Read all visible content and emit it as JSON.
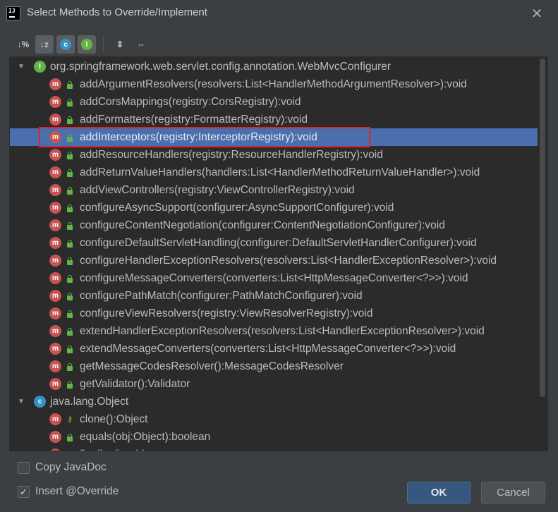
{
  "window": {
    "title": "Select Methods to Override/Implement",
    "close_glyph": "✕",
    "logo_text": "IJ"
  },
  "toolbar": {
    "sort_by_percent_glyph": "↓%",
    "sort_alpha_glyph": "↓z",
    "show_classes_glyph": "c",
    "show_interfaces_glyph": "I",
    "expand_all_glyph": "⇕",
    "collapse_all_glyph": "⇔"
  },
  "tree": {
    "groups": [
      {
        "label": "org.springframework.web.servlet.config.annotation.WebMvcConfigurer",
        "kind_glyph": "I",
        "kind_color": "#62b543",
        "expanded_glyph": "▼",
        "methods": [
          {
            "label": "addArgumentResolvers(resolvers:List<HandlerMethodArgumentResolver>):void",
            "visibility": "public"
          },
          {
            "label": "addCorsMappings(registry:CorsRegistry):void",
            "visibility": "public"
          },
          {
            "label": "addFormatters(registry:FormatterRegistry):void",
            "visibility": "public"
          },
          {
            "label": "addInterceptors(registry:InterceptorRegistry):void",
            "visibility": "public",
            "selected": true
          },
          {
            "label": "addResourceHandlers(registry:ResourceHandlerRegistry):void",
            "visibility": "public"
          },
          {
            "label": "addReturnValueHandlers(handlers:List<HandlerMethodReturnValueHandler>):void",
            "visibility": "public"
          },
          {
            "label": "addViewControllers(registry:ViewControllerRegistry):void",
            "visibility": "public"
          },
          {
            "label": "configureAsyncSupport(configurer:AsyncSupportConfigurer):void",
            "visibility": "public"
          },
          {
            "label": "configureContentNegotiation(configurer:ContentNegotiationConfigurer):void",
            "visibility": "public"
          },
          {
            "label": "configureDefaultServletHandling(configurer:DefaultServletHandlerConfigurer):void",
            "visibility": "public"
          },
          {
            "label": "configureHandlerExceptionResolvers(resolvers:List<HandlerExceptionResolver>):void",
            "visibility": "public"
          },
          {
            "label": "configureMessageConverters(converters:List<HttpMessageConverter<?>>):void",
            "visibility": "public"
          },
          {
            "label": "configurePathMatch(configurer:PathMatchConfigurer):void",
            "visibility": "public"
          },
          {
            "label": "configureViewResolvers(registry:ViewResolverRegistry):void",
            "visibility": "public"
          },
          {
            "label": "extendHandlerExceptionResolvers(resolvers:List<HandlerExceptionResolver>):void",
            "visibility": "public"
          },
          {
            "label": "extendMessageConverters(converters:List<HttpMessageConverter<?>>):void",
            "visibility": "public"
          },
          {
            "label": "getMessageCodesResolver():MessageCodesResolver",
            "visibility": "public"
          },
          {
            "label": "getValidator():Validator",
            "visibility": "public"
          }
        ]
      },
      {
        "label": "java.lang.Object",
        "kind_glyph": "c",
        "kind_color": "#3592c4",
        "expanded_glyph": "▼",
        "methods": [
          {
            "label": "clone():Object",
            "visibility": "protected"
          },
          {
            "label": "equals(obj:Object):boolean",
            "visibility": "public"
          },
          {
            "label": "finalize():void",
            "visibility": "protected"
          }
        ]
      }
    ],
    "method_glyph": "m",
    "key_glyph": "⚷"
  },
  "options": {
    "copy_javadoc": {
      "label": "Copy JavaDoc",
      "checked": false
    },
    "insert_override": {
      "label": "Insert @Override",
      "checked": true,
      "check_glyph": "✓"
    }
  },
  "buttons": {
    "ok": "OK",
    "cancel": "Cancel"
  }
}
